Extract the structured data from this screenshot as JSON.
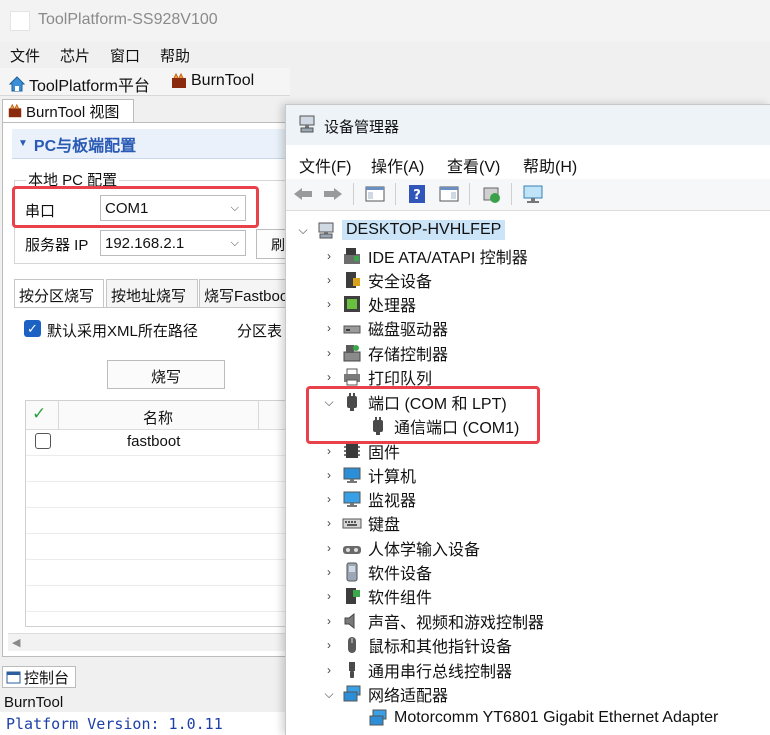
{
  "tool_platform": {
    "window_title": "ToolPlatform-SS928V100",
    "menu": [
      "文件",
      "芯片",
      "窗口",
      "帮助"
    ],
    "toolbar": {
      "platform_label": "ToolPlatform平台",
      "burntool_label": "BurnTool"
    },
    "view_tab": "BurnTool 视图",
    "config": {
      "section_title": "PC与板端配置",
      "local_pc_label": "本地 PC 配置",
      "serial_label": "串口",
      "serial_value": "COM1",
      "server_ip_label": "服务器 IP",
      "server_ip_value": "192.168.2.1",
      "refresh_label": "刷"
    },
    "tabs": [
      "按分区烧写",
      "按地址烧写",
      "烧写Fastboot"
    ],
    "use_xml_path_label": "默认采用XML所在路径",
    "partition_table_label": "分区表",
    "burn_button": "烧写",
    "table": {
      "name_header": "名称",
      "rows": [
        {
          "name": "fastboot",
          "checked": false
        }
      ]
    },
    "console": {
      "tab_label": "控制台",
      "name": "BurnTool",
      "output_line": "Platform Version: 1.0.11"
    }
  },
  "device_manager": {
    "title": "设备管理器",
    "menu": [
      "文件(F)",
      "操作(A)",
      "查看(V)",
      "帮助(H)"
    ],
    "root": "DESKTOP-HVHLFEP",
    "categories": [
      {
        "label": "IDE ATA/ATAPI 控制器",
        "icon": "ide-controller-icon",
        "expanded": false
      },
      {
        "label": "安全设备",
        "icon": "security-device-icon",
        "expanded": false
      },
      {
        "label": "处理器",
        "icon": "processor-icon",
        "expanded": false
      },
      {
        "label": "磁盘驱动器",
        "icon": "disk-drive-icon",
        "expanded": false
      },
      {
        "label": "存储控制器",
        "icon": "storage-controller-icon",
        "expanded": false
      },
      {
        "label": "打印队列",
        "icon": "printer-icon",
        "expanded": false
      },
      {
        "label": "端口 (COM 和 LPT)",
        "icon": "port-icon",
        "expanded": true,
        "children": [
          {
            "label": "通信端口 (COM1)",
            "icon": "port-icon"
          }
        ]
      },
      {
        "label": "固件",
        "icon": "firmware-icon",
        "expanded": false
      },
      {
        "label": "计算机",
        "icon": "computer-icon",
        "expanded": false
      },
      {
        "label": "监视器",
        "icon": "monitor-icon",
        "expanded": false
      },
      {
        "label": "键盘",
        "icon": "keyboard-icon",
        "expanded": false
      },
      {
        "label": "人体学输入设备",
        "icon": "hid-icon",
        "expanded": false
      },
      {
        "label": "软件设备",
        "icon": "software-device-icon",
        "expanded": false
      },
      {
        "label": "软件组件",
        "icon": "software-component-icon",
        "expanded": false
      },
      {
        "label": "声音、视频和游戏控制器",
        "icon": "audio-icon",
        "expanded": false
      },
      {
        "label": "鼠标和其他指针设备",
        "icon": "mouse-icon",
        "expanded": false
      },
      {
        "label": "通用串行总线控制器",
        "icon": "usb-icon",
        "expanded": false
      },
      {
        "label": "网络适配器",
        "icon": "network-adapter-icon",
        "expanded": true,
        "children": [
          {
            "label": "Motorcomm YT6801 Gigabit Ethernet Adapter",
            "icon": "network-adapter-icon"
          }
        ]
      }
    ]
  },
  "colors": {
    "accent_blue": "#2a5ab5",
    "highlight_red": "#e8414a",
    "selection_blue": "#cce4f7",
    "console_text": "#1e3faa"
  }
}
